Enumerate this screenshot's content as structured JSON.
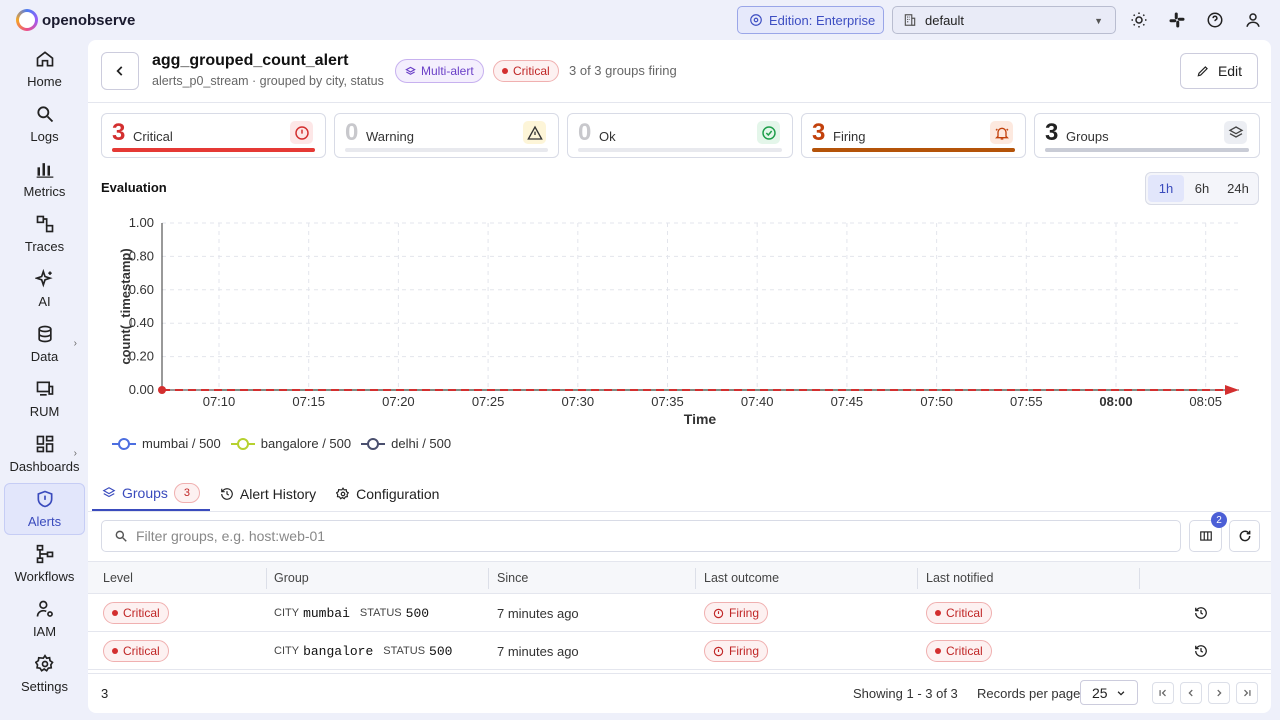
{
  "topbar": {
    "brand": "openobserve",
    "edition": "Edition: Enterprise",
    "org": "default"
  },
  "sidebar": {
    "items": [
      {
        "label": "Home",
        "icon": "home-icon"
      },
      {
        "label": "Logs",
        "icon": "search-icon"
      },
      {
        "label": "Metrics",
        "icon": "bar-chart-icon"
      },
      {
        "label": "Traces",
        "icon": "traces-icon"
      },
      {
        "label": "AI",
        "icon": "sparkle-icon"
      },
      {
        "label": "Data",
        "icon": "database-icon"
      },
      {
        "label": "RUM",
        "icon": "monitor-icon"
      },
      {
        "label": "Dashboards",
        "icon": "dashboard-icon"
      },
      {
        "label": "Alerts",
        "icon": "shield-alert-icon"
      },
      {
        "label": "Workflows",
        "icon": "workflow-icon"
      },
      {
        "label": "IAM",
        "icon": "user-gear-icon"
      },
      {
        "label": "Settings",
        "icon": "gear-icon"
      }
    ],
    "active": "Alerts"
  },
  "header": {
    "title": "agg_grouped_count_alert",
    "subtitle": "alerts_p0_stream · grouped by city, status",
    "multi_badge": "Multi-alert",
    "critical_badge": "Critical",
    "groups_firing": "3 of 3 groups firing",
    "edit_label": "Edit"
  },
  "stats": [
    {
      "value": "3",
      "label": "Critical",
      "color": "#d32f2f",
      "fill": 1.0
    },
    {
      "value": "0",
      "label": "Warning",
      "color": "#c9a000",
      "fill": 0
    },
    {
      "value": "0",
      "label": "Ok",
      "color": "#1e9e4a",
      "fill": 0
    },
    {
      "value": "3",
      "label": "Firing",
      "color": "#c2410c",
      "fill": 1.0
    },
    {
      "value": "3",
      "label": "Groups",
      "color": "#333333",
      "fill": 0
    }
  ],
  "evaluation": {
    "title": "Evaluation",
    "ranges": [
      "1h",
      "6h",
      "24h"
    ],
    "selected_range": "1h"
  },
  "chart_data": {
    "type": "line",
    "xlabel": "Time",
    "ylabel": "count(_timestamp)",
    "x_ticks": [
      "07:10",
      "07:15",
      "07:20",
      "07:25",
      "07:30",
      "07:35",
      "07:40",
      "07:45",
      "07:50",
      "07:55",
      "08:00",
      "08:05"
    ],
    "y_ticks": [
      "0.00",
      "0.20",
      "0.40",
      "0.60",
      "0.80",
      "1.00"
    ],
    "ylim": [
      0,
      1
    ],
    "grid": true,
    "series": [
      {
        "name": "mumbai / 500",
        "color": "#4c6ee0",
        "values": [
          0,
          0,
          0,
          0,
          0,
          0,
          0,
          0,
          0,
          0,
          0,
          0
        ]
      },
      {
        "name": "bangalore / 500",
        "color": "#b6d12f",
        "values": [
          0,
          0,
          0,
          0,
          0,
          0,
          0,
          0,
          0,
          0,
          0,
          0
        ]
      },
      {
        "name": "delhi / 500",
        "color": "#4a4f6e",
        "values": [
          0,
          0,
          0,
          0,
          0,
          0,
          0,
          0,
          0,
          0,
          0,
          0
        ]
      }
    ],
    "threshold": {
      "value": 0,
      "color": "#d32f2f"
    }
  },
  "tabs": [
    {
      "label": "Groups",
      "count": "3",
      "icon": "layers-icon"
    },
    {
      "label": "Alert History",
      "icon": "history-icon"
    },
    {
      "label": "Configuration",
      "icon": "gear-icon"
    }
  ],
  "filter": {
    "placeholder": "Filter groups, e.g. host:web-01",
    "columns_badge": "2"
  },
  "table": {
    "columns": [
      "Level",
      "Group",
      "Since",
      "Last outcome",
      "Last notified"
    ],
    "rows": [
      {
        "level": "Critical",
        "group": [
          {
            "k": "CITY",
            "v": "mumbai"
          },
          {
            "k": "STATUS",
            "v": "500"
          }
        ],
        "since": "7 minutes ago",
        "outcome": "Firing",
        "notified": "Critical"
      },
      {
        "level": "Critical",
        "group": [
          {
            "k": "CITY",
            "v": "bangalore"
          },
          {
            "k": "STATUS",
            "v": "500"
          }
        ],
        "since": "7 minutes ago",
        "outcome": "Firing",
        "notified": "Critical"
      }
    ]
  },
  "footer": {
    "total": "3",
    "showing": "Showing 1 - 3 of 3",
    "records_per_page_label": "Records per page",
    "records_per_page": "25"
  }
}
